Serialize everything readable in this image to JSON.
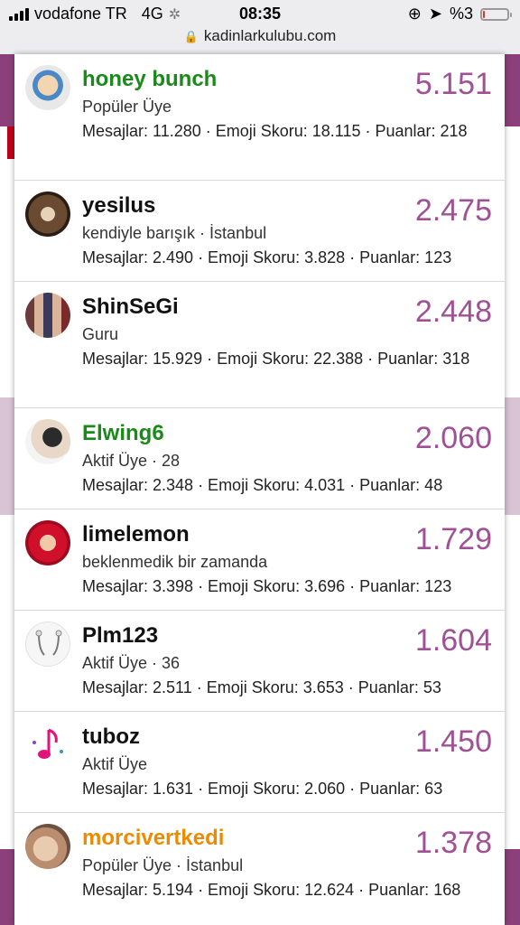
{
  "status": {
    "carrier": "vodafone TR",
    "network": "4G",
    "time": "08:35",
    "battery": "%3"
  },
  "browser": {
    "url": "kadinlarkulubu.com"
  },
  "colors": {
    "score": "#a05193",
    "green_name": "#1a8a1a",
    "orange_name": "#ee8a00"
  },
  "users": [
    {
      "name": "honey bunch",
      "title": "Popüler Üye",
      "stats": "Mesajlar: 11.280 · Emoji Skoru: 18.115 · Puanlar: 218",
      "score": "5.151"
    },
    {
      "name": "yesilus",
      "title": "kendiyle barışık · İstanbul",
      "stats": "Mesajlar: 2.490 · Emoji Skoru: 3.828 · Puanlar: 123",
      "score": "2.475"
    },
    {
      "name": "ShinSeGi",
      "title": "Guru",
      "stats": "Mesajlar: 15.929 · Emoji Skoru: 22.388 · Puanlar: 318",
      "score": "2.448"
    },
    {
      "name": "Elwing6",
      "title": "Aktif Üye · 28",
      "stats": "Mesajlar: 2.348 · Emoji Skoru: 4.031 · Puanlar: 48",
      "score": "2.060"
    },
    {
      "name": "limelemon",
      "title": "beklenmedik bir zamanda",
      "stats": "Mesajlar: 3.398 · Emoji Skoru: 3.696 · Puanlar: 123",
      "score": "1.729"
    },
    {
      "name": "Plm123",
      "title": "Aktif Üye · 36",
      "stats": "Mesajlar: 2.511 · Emoji Skoru: 3.653 · Puanlar: 53",
      "score": "1.604"
    },
    {
      "name": "tuboz",
      "title": "Aktif Üye",
      "stats": "Mesajlar: 1.631 · Emoji Skoru: 2.060 · Puanlar: 63",
      "score": "1.450"
    },
    {
      "name": "morcivertkedi",
      "title": "Popüler Üye · İstanbul",
      "stats": "Mesajlar: 5.194 · Emoji Skoru: 12.624 · Puanlar: 168",
      "score": "1.378"
    }
  ]
}
